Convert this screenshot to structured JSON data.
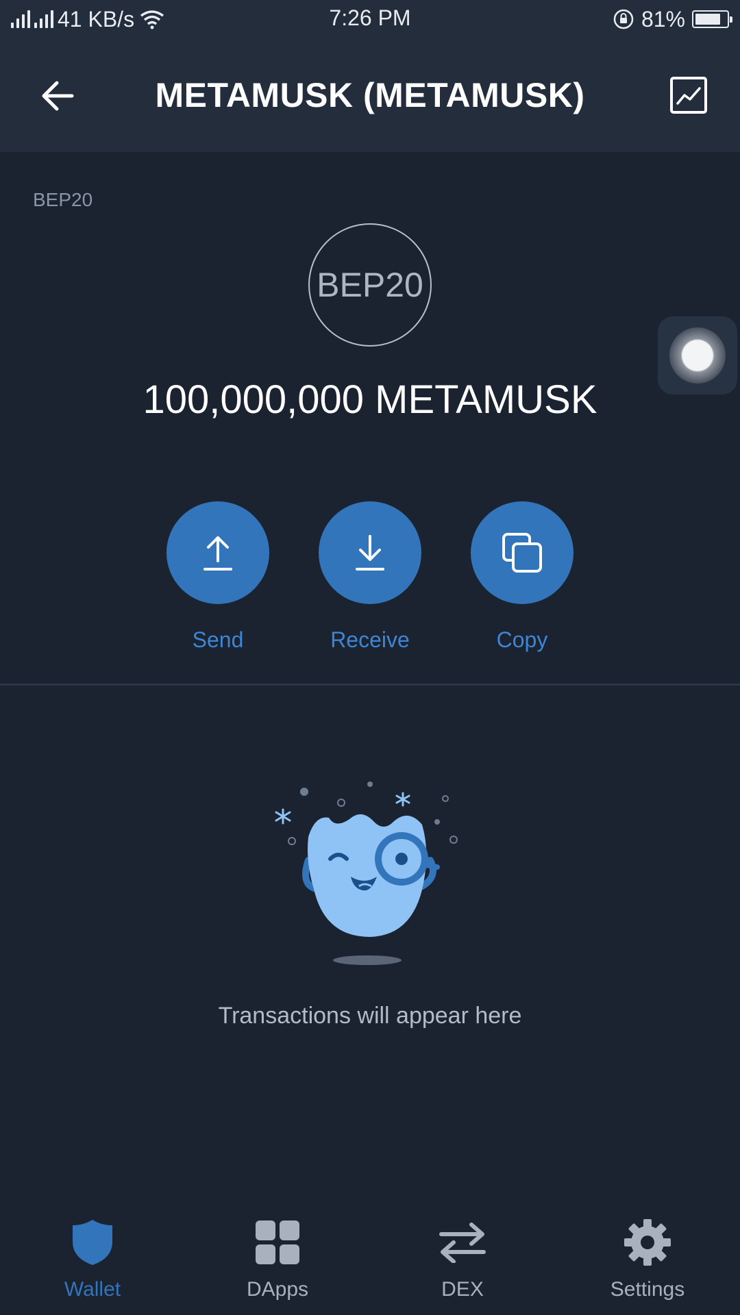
{
  "status_bar": {
    "network_speed": "41 KB/s",
    "time": "7:26 PM",
    "battery_percent": "81%",
    "battery_level": 0.81
  },
  "header": {
    "title": "METAMUSK (METAMUSK)",
    "back_icon": "arrow-left-icon",
    "chart_icon": "line-chart-icon"
  },
  "token": {
    "network_label": "BEP20",
    "logo_text": "BEP20",
    "balance": "100,000,000 METAMUSK"
  },
  "actions": [
    {
      "label": "Send",
      "icon": "upload-arrow-icon"
    },
    {
      "label": "Receive",
      "icon": "download-arrow-icon"
    },
    {
      "label": "Copy",
      "icon": "copy-icon"
    }
  ],
  "empty_state": {
    "message": "Transactions will appear here"
  },
  "bottom_nav": [
    {
      "label": "Wallet",
      "icon": "shield-icon",
      "active": true
    },
    {
      "label": "DApps",
      "icon": "grid-icon",
      "active": false
    },
    {
      "label": "DEX",
      "icon": "swap-arrows-icon",
      "active": false
    },
    {
      "label": "Settings",
      "icon": "gear-icon",
      "active": false
    }
  ],
  "colors": {
    "background": "#1b2230",
    "header": "#232d3b",
    "accent": "#3375bb",
    "muted_text": "#8a95a5"
  }
}
